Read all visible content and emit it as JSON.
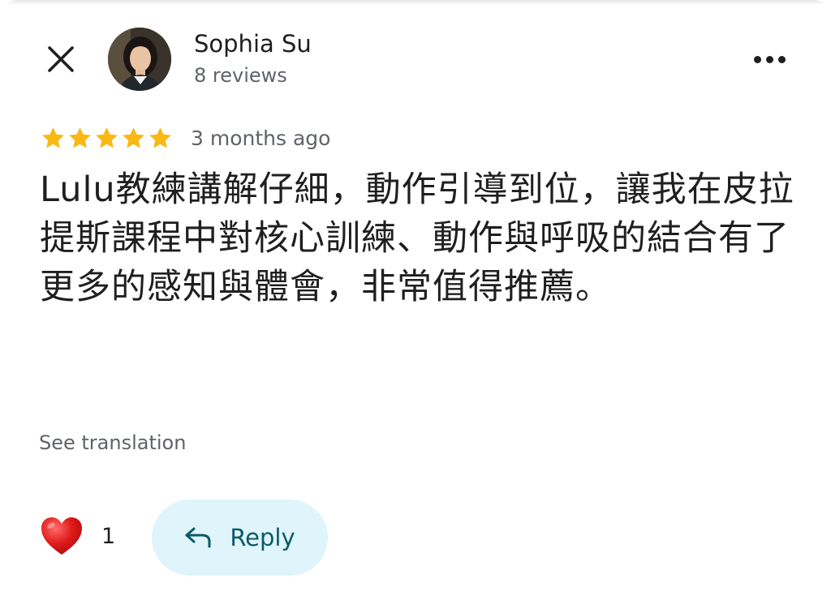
{
  "reviewer": {
    "name": "Sophia Su",
    "reviews_count": "8 reviews"
  },
  "rating": {
    "stars": 5,
    "max_stars": 5,
    "star_color": "#F9B814",
    "time_ago": "3 months ago"
  },
  "review": {
    "text": "Lulu教練講解仔細，動作引導到位，讓我在皮拉提斯課程中對核心訓練、動作與呼吸的結合有了更多的感知與體會，非常值得推薦。",
    "see_translation": "See translation"
  },
  "actions": {
    "like_count": "1",
    "reply_label": "Reply",
    "reply_bg": "#DFF4FB",
    "reply_color": "#0B5A68"
  },
  "icons": {
    "close": "close-icon",
    "more": "more-icon",
    "heart": "heart-icon",
    "reply": "reply-arrow-icon"
  }
}
